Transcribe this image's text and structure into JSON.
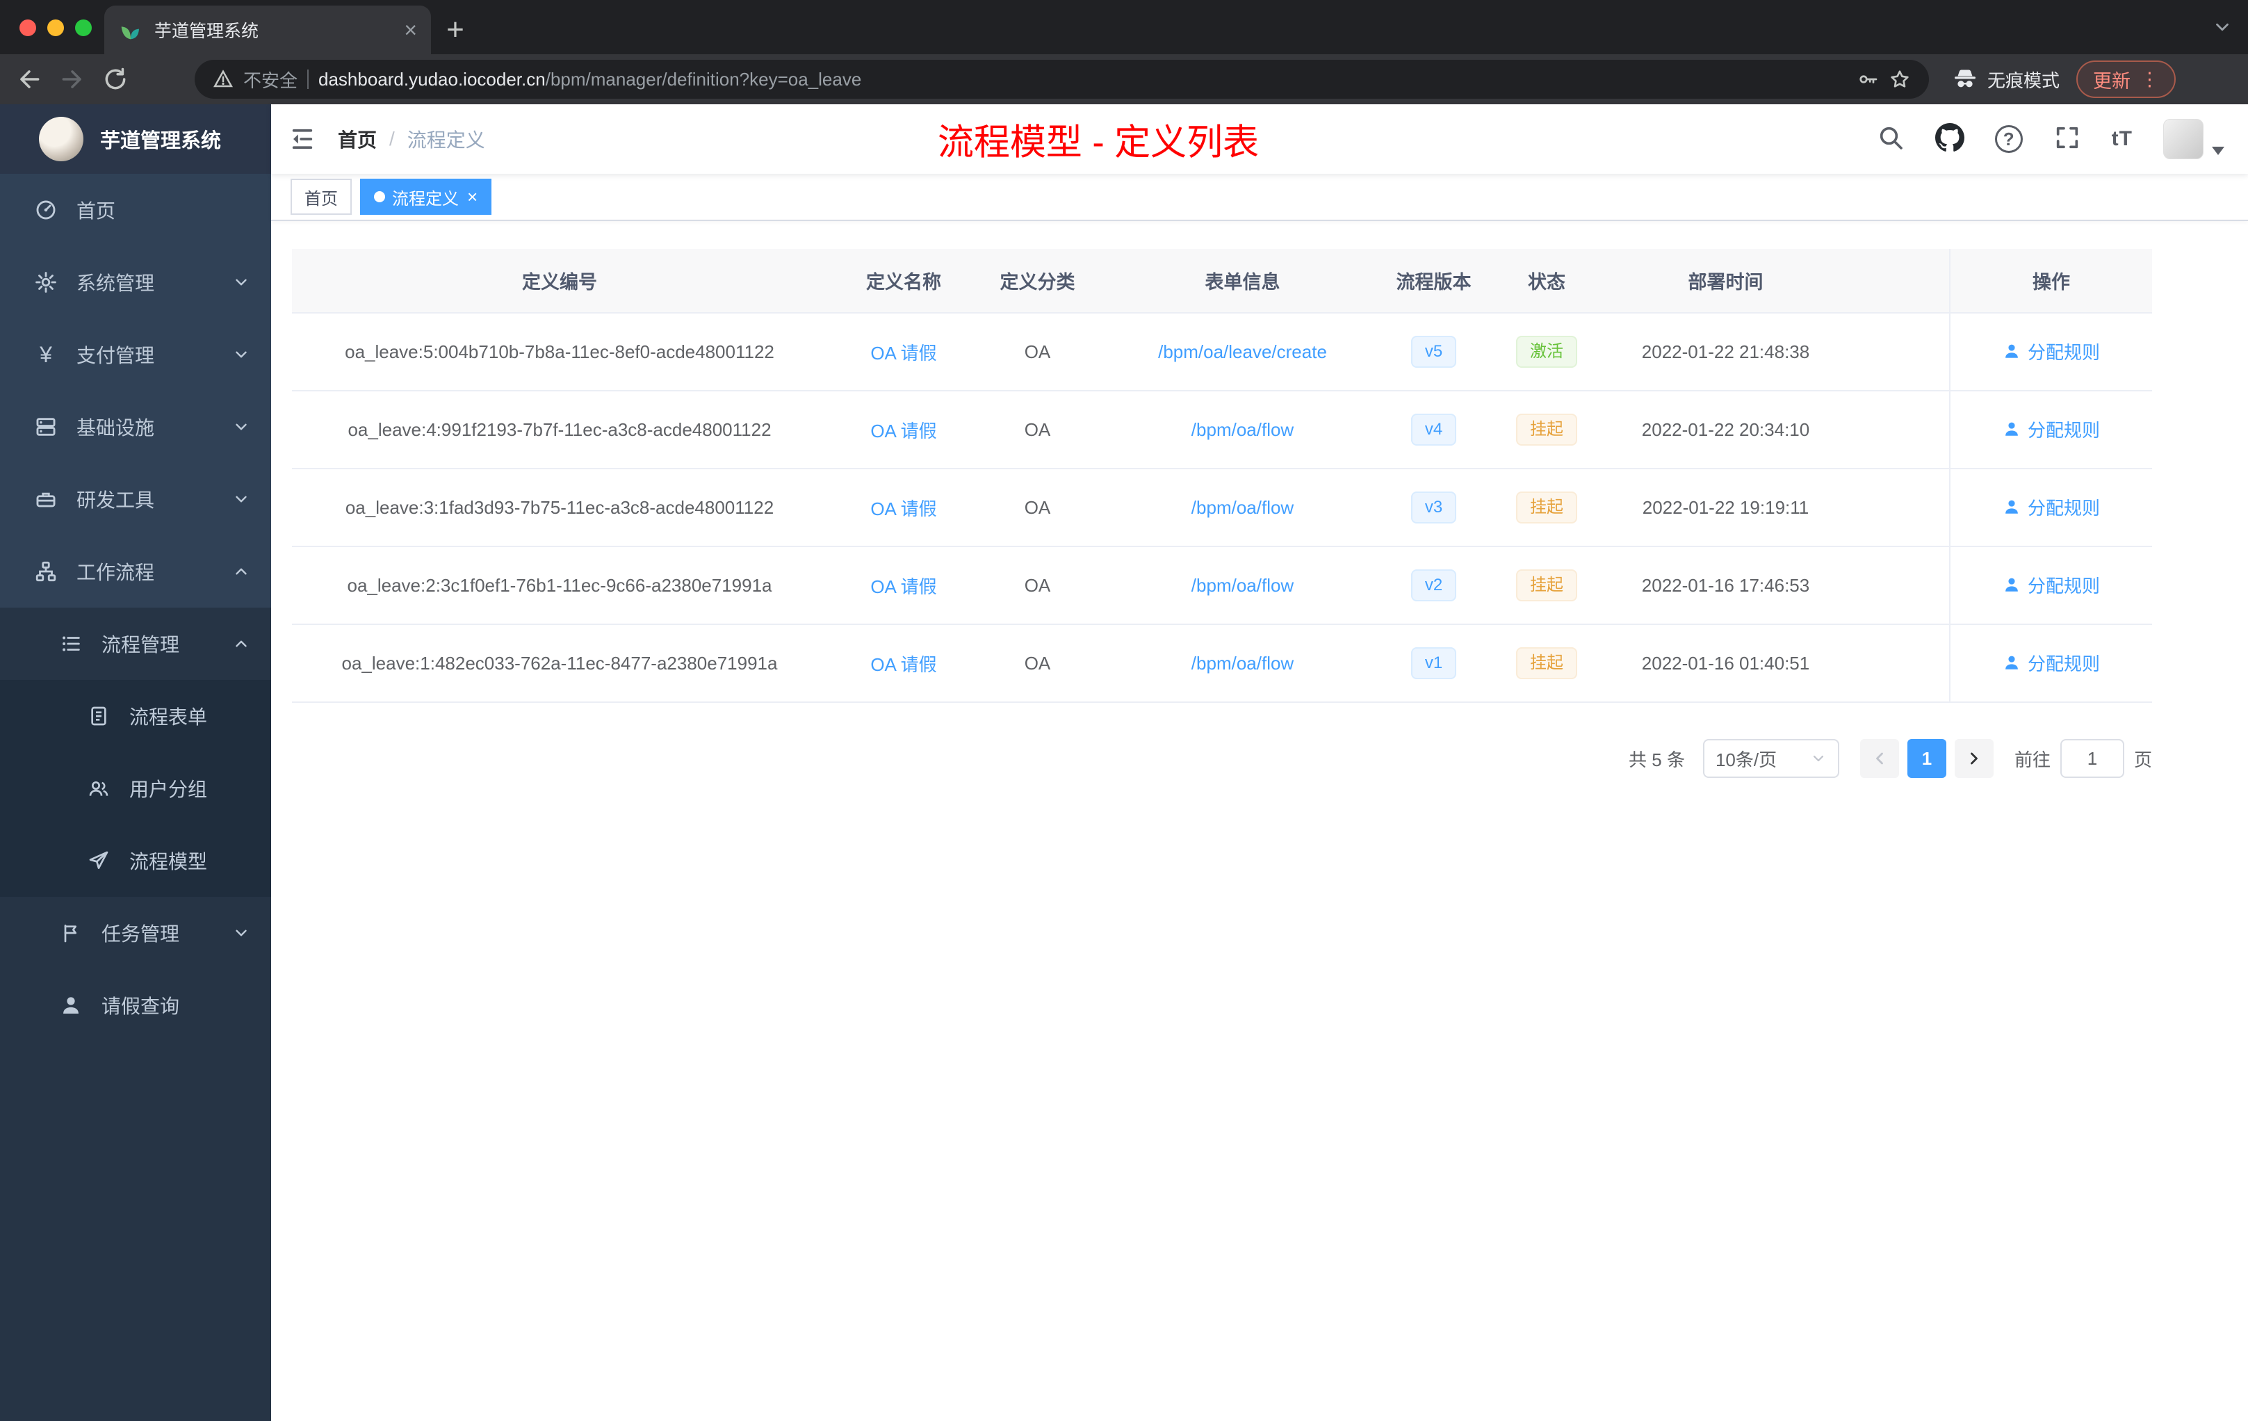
{
  "colors": {
    "accent_blue": "#409eff",
    "success_green": "#67c23a",
    "warning_orange": "#e6a23c",
    "annotation_red": "#ff0000",
    "sidebar_bg": "#304156"
  },
  "glyphs": {
    "close": "×",
    "plus": "+",
    "kebab": "⋮",
    "question": "?",
    "yen": "¥"
  },
  "browser": {
    "tab_title": "芋道管理系统",
    "security_label": "不安全",
    "url_domain": "dashboard.yudao.iocoder.cn",
    "url_path": "/bpm/manager/definition?key=oa_leave",
    "incognito_label": "无痕模式",
    "update_label": "更新"
  },
  "sidebar": {
    "app_title": "芋道管理系统",
    "items": [
      {
        "label": "首页"
      },
      {
        "label": "系统管理"
      },
      {
        "label": "支付管理"
      },
      {
        "label": "基础设施"
      },
      {
        "label": "研发工具"
      },
      {
        "label": "工作流程"
      },
      {
        "label": "流程管理"
      },
      {
        "label": "流程表单"
      },
      {
        "label": "用户分组"
      },
      {
        "label": "流程模型"
      },
      {
        "label": "任务管理"
      },
      {
        "label": "请假查询"
      }
    ]
  },
  "header": {
    "breadcrumb": {
      "home": "首页",
      "separator": "/",
      "current": "流程定义"
    },
    "annotation": "流程模型 - 定义列表",
    "font_size_icon": "tT"
  },
  "tags": {
    "home_label": "首页",
    "active_label": "流程定义"
  },
  "table": {
    "columns": [
      "定义编号",
      "定义名称",
      "定义分类",
      "表单信息",
      "流程版本",
      "状态",
      "部署时间",
      "操作"
    ],
    "rows": [
      {
        "id": "oa_leave:5:004b710b-7b8a-11ec-8ef0-acde48001122",
        "name": "OA 请假",
        "category": "OA",
        "form": "/bpm/oa/leave/create",
        "version": "v5",
        "status": "激活",
        "status_type": "success",
        "deploy_time": "2022-01-22 21:48:38",
        "action_label": "分配规则"
      },
      {
        "id": "oa_leave:4:991f2193-7b7f-11ec-a3c8-acde48001122",
        "name": "OA 请假",
        "category": "OA",
        "form": "/bpm/oa/flow",
        "version": "v4",
        "status": "挂起",
        "status_type": "warning",
        "deploy_time": "2022-01-22 20:34:10",
        "action_label": "分配规则"
      },
      {
        "id": "oa_leave:3:1fad3d93-7b75-11ec-a3c8-acde48001122",
        "name": "OA 请假",
        "category": "OA",
        "form": "/bpm/oa/flow",
        "version": "v3",
        "status": "挂起",
        "status_type": "warning",
        "deploy_time": "2022-01-22 19:19:11",
        "action_label": "分配规则"
      },
      {
        "id": "oa_leave:2:3c1f0ef1-76b1-11ec-9c66-a2380e71991a",
        "name": "OA 请假",
        "category": "OA",
        "form": "/bpm/oa/flow",
        "version": "v2",
        "status": "挂起",
        "status_type": "warning",
        "deploy_time": "2022-01-16 17:46:53",
        "action_label": "分配规则"
      },
      {
        "id": "oa_leave:1:482ec033-762a-11ec-8477-a2380e71991a",
        "name": "OA 请假",
        "category": "OA",
        "form": "/bpm/oa/flow",
        "version": "v1",
        "status": "挂起",
        "status_type": "warning",
        "deploy_time": "2022-01-16 01:40:51",
        "action_label": "分配规则"
      }
    ]
  },
  "pagination": {
    "total_label": "共 5 条",
    "page_size_label": "10条/页",
    "current_page": "1",
    "goto_label": "前往",
    "goto_value": "1",
    "page_unit_label": "页"
  }
}
